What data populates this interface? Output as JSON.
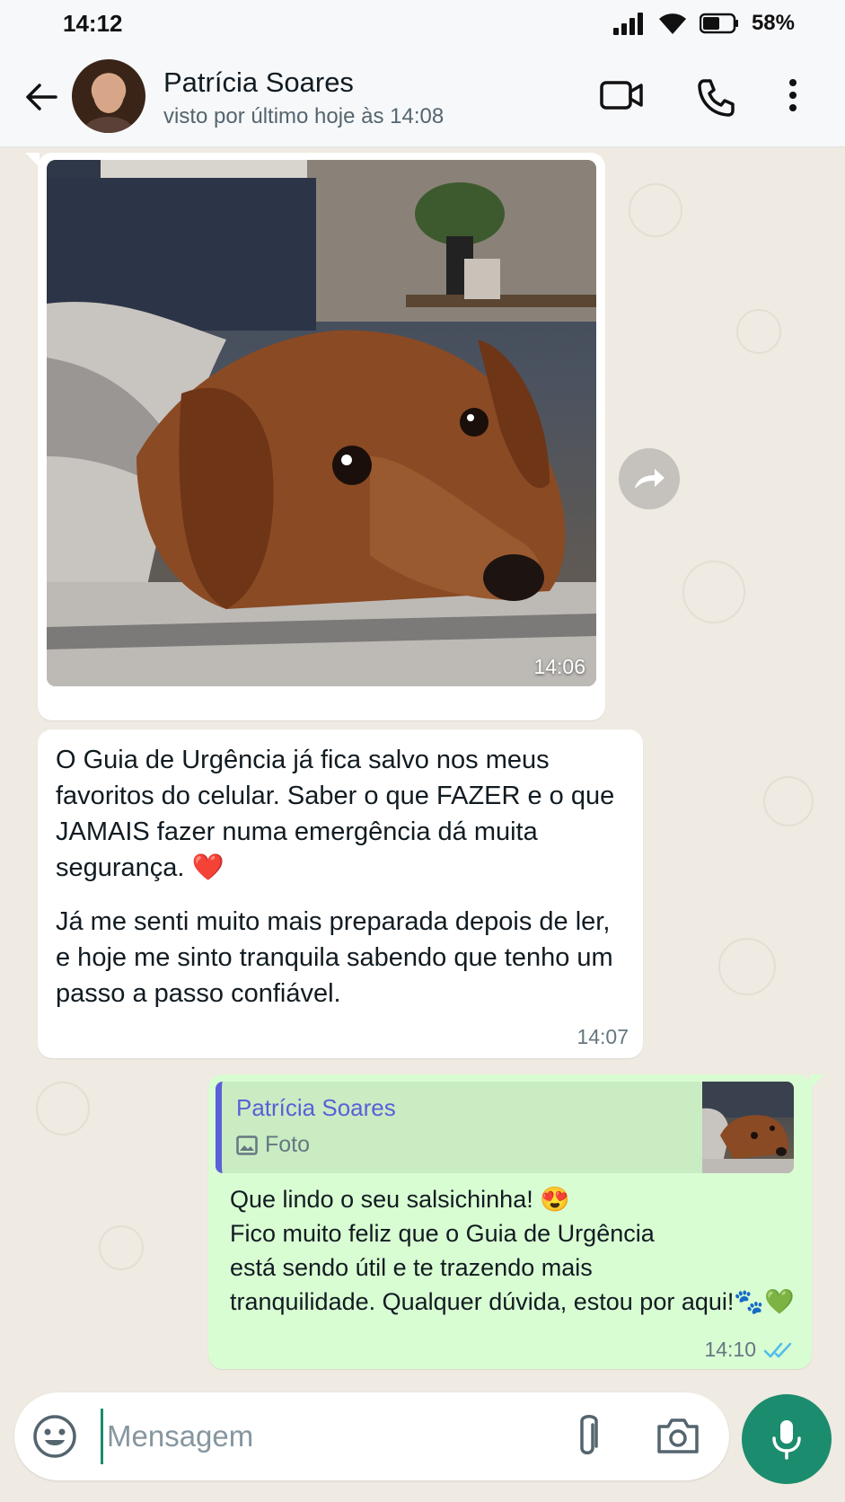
{
  "status_bar": {
    "time": "14:12",
    "battery_pct": "58%",
    "icons": [
      "signal-icon",
      "wifi-icon",
      "battery-icon"
    ]
  },
  "header": {
    "contact_name": "Patrícia Soares",
    "last_seen": "visto por último hoje às 14:08",
    "icons": [
      "back-arrow-icon",
      "video-call-icon",
      "voice-call-icon",
      "more-options-icon"
    ]
  },
  "messages": {
    "image_message": {
      "time": "14:06",
      "alt": "photo-dachshund"
    },
    "incoming_text": {
      "paragraph1": "O Guia de Urgência já fica salvo nos meus favoritos do celular. Saber o que FAZER e o que JAMAIS fazer numa emergência dá muita segurança. ❤️",
      "paragraph2": "Já me senti muito mais preparada depois de ler, e hoje me sinto tranquila sabendo que tenho um passo a passo confiável.",
      "time": "14:07"
    },
    "outgoing_reply": {
      "quote_author": "Patrícia Soares",
      "quote_type": "Foto",
      "line1": "Que lindo o seu salsichinha! 😍",
      "line2": "Fico muito feliz que o Guia de Urgência",
      "line3": "está sendo útil e te trazendo mais",
      "line4": "tranquilidade. Qualquer dúvida, estou por aqui!🐾💚",
      "time": "14:10",
      "read_status": "read"
    }
  },
  "input_bar": {
    "placeholder": "Mensagem",
    "value": ""
  },
  "colors": {
    "accent": "#1c8c6e",
    "outgoing_bubble": "#d9fdd3",
    "chat_background": "#efeae2",
    "read_ticks": "#53bdeb",
    "quote_bar": "#5b5fd8"
  }
}
